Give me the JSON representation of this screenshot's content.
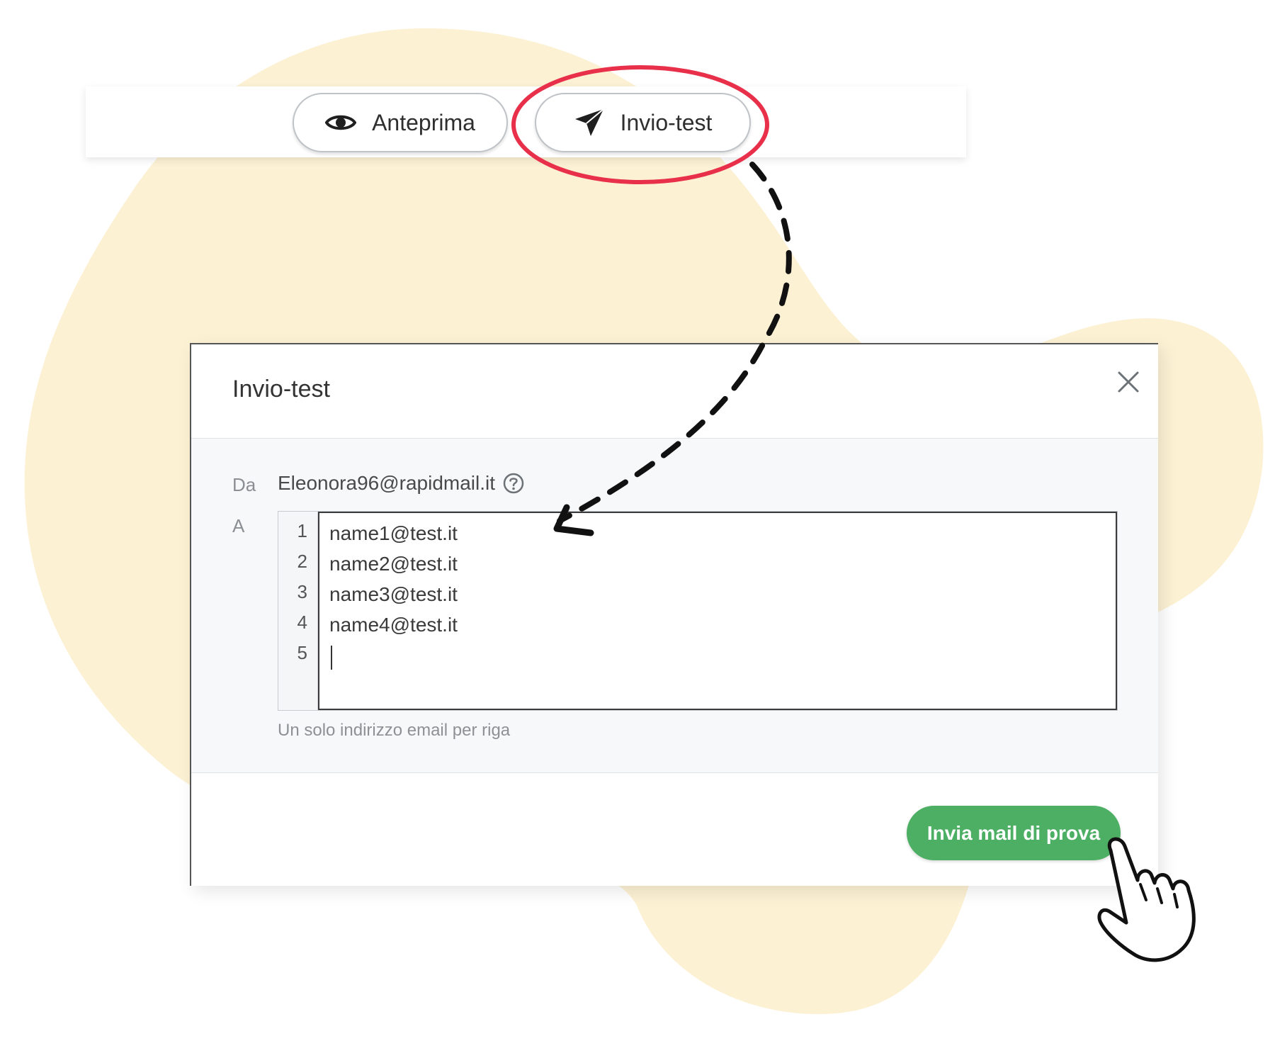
{
  "toolbar": {
    "preview_label": "Anteprima",
    "test_label": "Invio-test",
    "preview_icon": "eye-icon",
    "test_icon": "paper-plane-icon"
  },
  "modal": {
    "title": "Invio-test",
    "from_label": "Da",
    "from_value": "Eleonora96@rapidmail.it",
    "to_label": "A",
    "line_numbers": [
      "1",
      "2",
      "3",
      "4",
      "5"
    ],
    "recipients": [
      "name1@test.it",
      "name2@test.it",
      "name3@test.it",
      "name4@test.it"
    ],
    "hint": "Un solo indirizzo email per riga",
    "send_label": "Invia mail di prova",
    "close_icon": "close-icon",
    "help_icon": "help-icon"
  },
  "colors": {
    "blob": "#fdf1d4",
    "highlight_ring": "#e8304a",
    "send_button": "#4caf63",
    "arrow": "#111111"
  }
}
